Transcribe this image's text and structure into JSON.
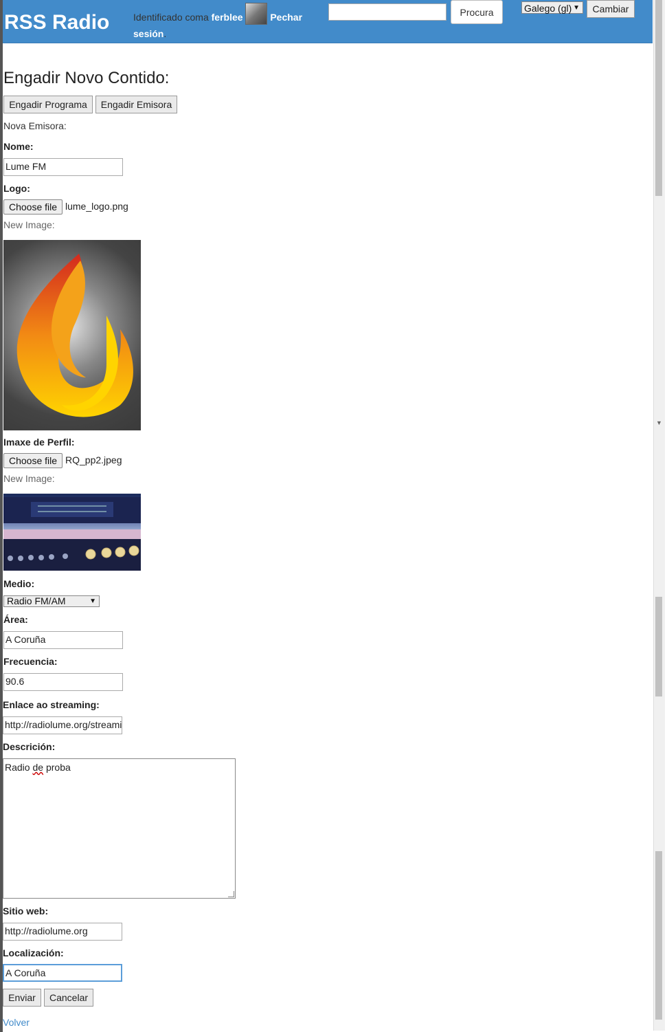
{
  "header": {
    "brand": "RSS Radio",
    "identified_prefix": "Identificado coma",
    "username": "ferblee",
    "logout_line1": "Pechar",
    "logout_line2": "sesión",
    "logout_suffix": ".",
    "search_button": "Procura",
    "language_selected": "Galego (gl)",
    "language_button": "Cambiar"
  },
  "form": {
    "heading": "Engadir Novo Contido:",
    "add_program_button": "Engadir Programa",
    "add_station_button": "Engadir Emisora",
    "subtitle": "Nova Emisora:",
    "name_label": "Nome:",
    "name_value": "Lume FM",
    "logo_label": "Logo:",
    "choose_file": "Choose file",
    "logo_filename": "lume_logo.png",
    "new_image_label": "New Image:",
    "profile_label": "Imaxe de Perfil:",
    "profile_filename": "RQ_pp2.jpeg",
    "medium_label": "Medio:",
    "medium_value": "Radio FM/AM",
    "area_label": "Área:",
    "area_value": "A Coruña",
    "frequency_label": "Frecuencia:",
    "frequency_value": "90.6",
    "stream_label": "Enlace ao streaming:",
    "stream_value": "http://radiolume.org/streaming",
    "description_label": "Descrición:",
    "description_word1": "Radio",
    "description_word2": "de",
    "description_word3": "proba",
    "website_label": "Sitio web:",
    "website_value": "http://radiolume.org",
    "location_label": "Localización:",
    "location_value": "A Coruña",
    "submit_button": "Enviar",
    "cancel_button": "Cancelar",
    "back_link": "Volver"
  },
  "colors": {
    "header_bg": "#428bca",
    "link": "#428bca"
  },
  "icons": {
    "logo_image": "flame-logo",
    "profile_image": "radio-receiver-photo",
    "avatar": "user-avatar"
  }
}
